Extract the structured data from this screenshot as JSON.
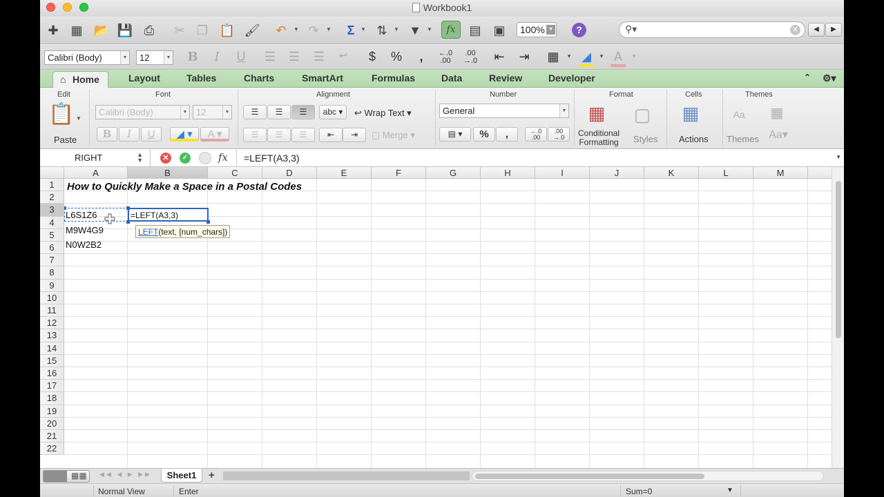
{
  "window": {
    "title": "Workbook1"
  },
  "toolbar": {
    "zoom": "100%",
    "search_placeholder": ""
  },
  "format_bar": {
    "font_name": "Calibri (Body)",
    "font_size": "12"
  },
  "tabs": [
    "Home",
    "Layout",
    "Tables",
    "Charts",
    "SmartArt",
    "Formulas",
    "Data",
    "Review",
    "Developer"
  ],
  "ribbon": {
    "groups": {
      "edit": "Edit",
      "font": "Font",
      "alignment": "Alignment",
      "number": "Number",
      "format": "Format",
      "cells": "Cells",
      "themes": "Themes"
    },
    "paste": "Paste",
    "font_name": "Calibri (Body)",
    "font_size": "12",
    "wrap_text": "Wrap Text",
    "merge": "Merge",
    "abc": "abc",
    "number_format": "General",
    "conditional_formatting_1": "Conditional",
    "conditional_formatting_2": "Formatting",
    "styles": "Styles",
    "actions": "Actions",
    "themes": "Themes"
  },
  "formula_bar": {
    "name_box": "RIGHT",
    "fx": "fx",
    "formula": "=LEFT(A3,3)"
  },
  "columns": [
    "A",
    "B",
    "C",
    "D",
    "E",
    "F",
    "G",
    "H",
    "I",
    "J",
    "K",
    "L",
    "M"
  ],
  "rows": [
    "1",
    "2",
    "3",
    "4",
    "5",
    "6",
    "7",
    "8",
    "9",
    "10",
    "11",
    "12",
    "13",
    "14",
    "15",
    "16",
    "17",
    "18",
    "19",
    "20",
    "21",
    "22"
  ],
  "cells": {
    "a1": "How to Quickly Make a Space in a Postal Codes",
    "a3": "L6S1Z6",
    "a4": "M9W4G9",
    "a5": "N0W2B2",
    "b3": "=LEFT(A3,3)"
  },
  "tooltip": {
    "function": "LEFT",
    "args": "(text, [num_chars])"
  },
  "sheet": {
    "tab": "Sheet1",
    "add": "+"
  },
  "status": {
    "view": "Normal View",
    "mode": "Enter",
    "sum": "Sum=0"
  },
  "colors": {
    "tab_bar": "#b9dcb2",
    "selection": "#2b63c4",
    "fx_button": "#8fbe8b"
  }
}
